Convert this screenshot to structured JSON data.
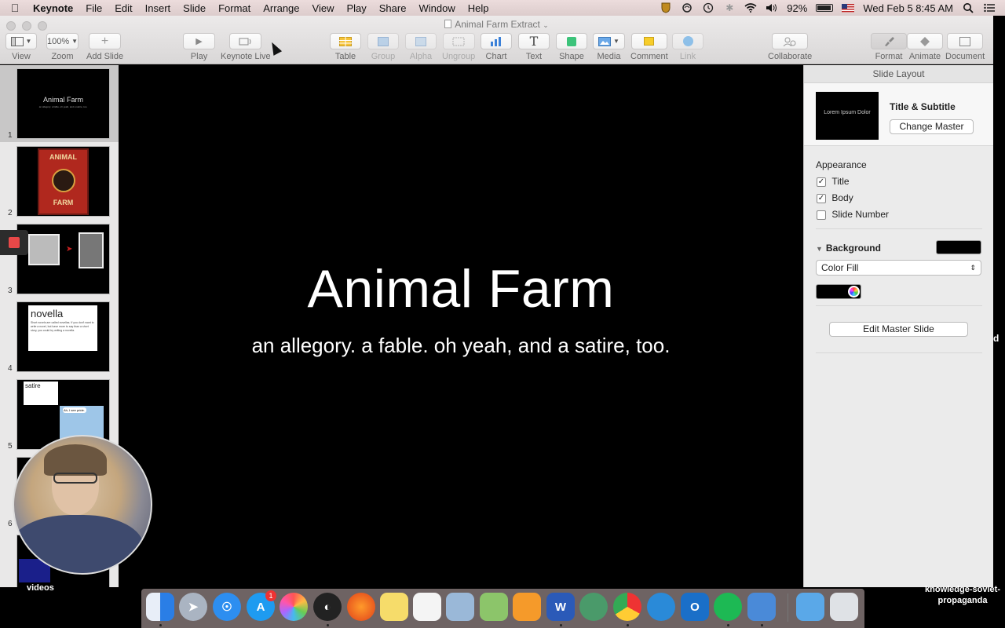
{
  "menubar": {
    "app": "Keynote",
    "items": [
      "File",
      "Edit",
      "Insert",
      "Slide",
      "Format",
      "Arrange",
      "View",
      "Play",
      "Share",
      "Window",
      "Help"
    ],
    "battery": "92%",
    "battery_level": 0.92,
    "datetime": "Wed Feb 5  8:45 AM"
  },
  "window": {
    "title": "Animal Farm Extract"
  },
  "toolbar": {
    "view": "View",
    "zoom": "Zoom",
    "zoom_value": "100%",
    "add_slide": "Add Slide",
    "play": "Play",
    "keynote_live": "Keynote Live",
    "table": "Table",
    "group": "Group",
    "alpha": "Alpha",
    "ungroup": "Ungroup",
    "chart": "Chart",
    "text": "Text",
    "shape": "Shape",
    "media": "Media",
    "comment": "Comment",
    "link": "Link",
    "collaborate": "Collaborate",
    "format": "Format",
    "animate": "Animate",
    "document": "Document"
  },
  "navigator": {
    "slides": [
      {
        "number": "1",
        "title": "Animal Farm",
        "subtitle": "an allegory. a fable. oh yeah, and a satire, too."
      },
      {
        "number": "2",
        "title": "ANIMAL",
        "subtitle": "FARM"
      },
      {
        "number": "3"
      },
      {
        "number": "4",
        "title": "novella",
        "body": "Short novels are called novellas. If you don't want to write a novel, but have more to say than a short story, you could try writing a novella."
      },
      {
        "number": "5",
        "title": "satire",
        "bubble": "Ah, I see pride."
      },
      {
        "number": "6"
      }
    ]
  },
  "slide": {
    "title": "Animal Farm",
    "subtitle": "an allegory. a fable. oh yeah, and a satire, too."
  },
  "inspector": {
    "header": "Slide Layout",
    "master_name": "Title & Subtitle",
    "master_thumb_text": "Lorem Ipsum Dolor",
    "change_master": "Change Master",
    "appearance": "Appearance",
    "title_label": "Title",
    "body_label": "Body",
    "slide_number_label": "Slide Number",
    "background": "Background",
    "fill_type": "Color Fill",
    "edit_master": "Edit Master Slide",
    "colors": {
      "background_fill": "#000000"
    }
  },
  "overlay": {
    "right_text": "knowledge-soviet-propaganda",
    "left_text": "videos",
    "edge_char": "d"
  },
  "dock": {
    "icons": [
      "finder-icon",
      "launchpad-icon",
      "safari-icon",
      "app-store-icon",
      "photos-icon",
      "dashboard-icon",
      "firefox-icon",
      "notes-icon",
      "reminders-icon",
      "preview-icon",
      "maps-icon",
      "books-icon",
      "word-icon",
      "network-icon",
      "chrome-icon",
      "screen-share-icon",
      "outlook-icon",
      "spotify-icon",
      "keynote-icon",
      "downloads-icon",
      "trash-icon"
    ],
    "badge": "1"
  }
}
